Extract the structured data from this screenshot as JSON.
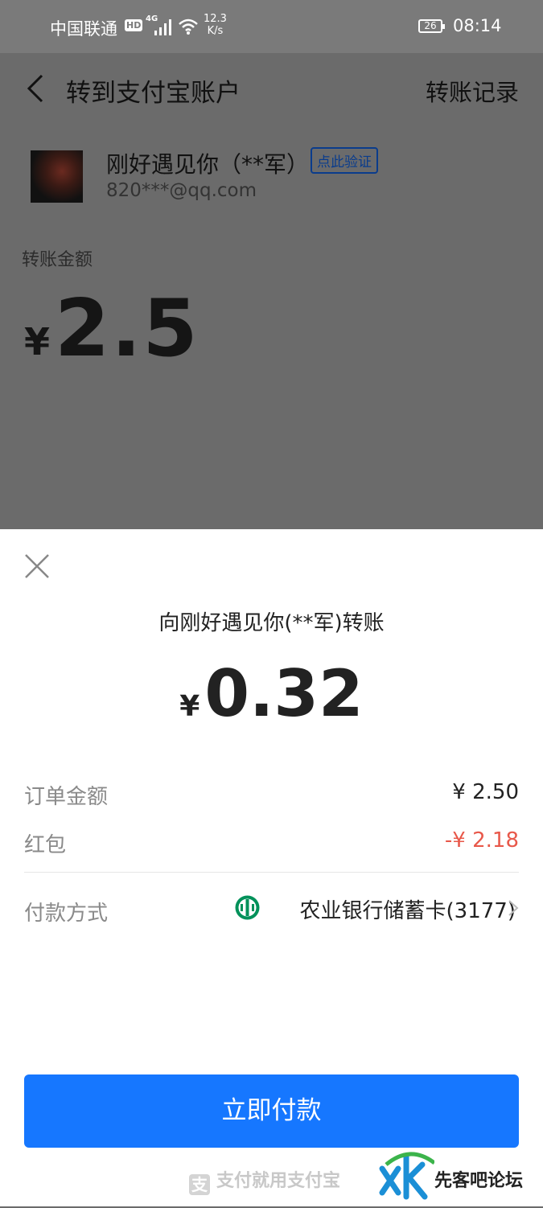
{
  "status_bar": {
    "carrier": "中国联通",
    "hd": "HD",
    "network": "4G",
    "speed_value": "12.3",
    "speed_unit": "K/s",
    "battery": "26",
    "time": "08:14"
  },
  "header": {
    "title": "转到支付宝账户",
    "history_label": "转账记录"
  },
  "recipient": {
    "name": "刚好遇见你（**军）",
    "verify_label": "点此验证",
    "account": "820***@qq.com"
  },
  "transfer": {
    "amount_label": "转账金额",
    "currency_symbol": "¥",
    "amount": "2.5"
  },
  "payment_sheet": {
    "title": "向刚好遇见你(**军)转账",
    "currency_symbol": "¥",
    "amount": "0.32",
    "order_amount_label": "订单金额",
    "order_amount_value": "¥ 2.50",
    "red_packet_label": "红包",
    "red_packet_value": "-¥ 2.18",
    "payment_method_label": "付款方式",
    "payment_method_value": "农业银行储蓄卡(3177)",
    "pay_button_label": "立即付款",
    "footer": "支付就用支付宝"
  },
  "watermark": {
    "text": "先客吧论坛"
  },
  "colors": {
    "primary": "#1677ff",
    "discount_red": "#e8584a",
    "bank_green": "#00915a",
    "overlay": "#6b6b6b"
  }
}
